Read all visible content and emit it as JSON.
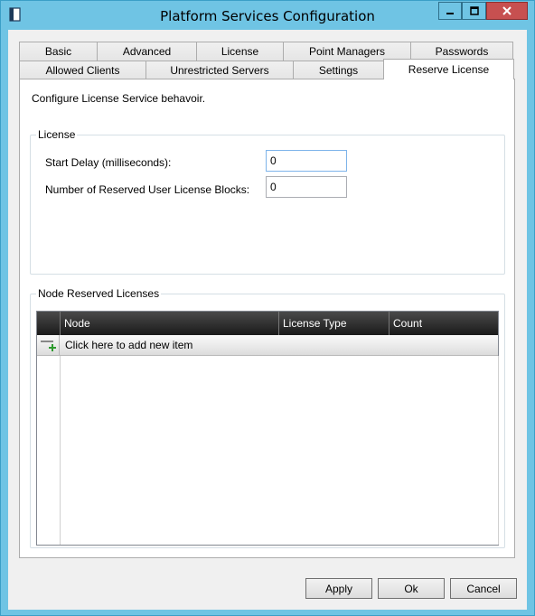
{
  "window": {
    "title": "Platform Services Configuration"
  },
  "tabs": {
    "row1": [
      "Basic",
      "Advanced",
      "License",
      "Point Managers",
      "Passwords"
    ],
    "row2": [
      "Allowed Clients",
      "Unrestricted Servers",
      "Settings",
      "Reserve License"
    ],
    "active": "Reserve License"
  },
  "panel": {
    "description": "Configure License Service behavoir.",
    "license_group": {
      "title": "License",
      "start_delay_label": "Start Delay (milliseconds):",
      "start_delay_value": "0",
      "reserved_blocks_label": "Number of Reserved User License Blocks:",
      "reserved_blocks_value": "0"
    },
    "node_group": {
      "title": "Node Reserved Licenses",
      "columns": [
        "Node",
        "License Type",
        "Count"
      ],
      "new_item_text": "Click here to add new item"
    }
  },
  "buttons": {
    "apply": "Apply",
    "ok": "Ok",
    "cancel": "Cancel"
  },
  "colors": {
    "titlebar": "#6fc4e4",
    "close": "#c75050",
    "grid_header": "#1a1a1a"
  }
}
